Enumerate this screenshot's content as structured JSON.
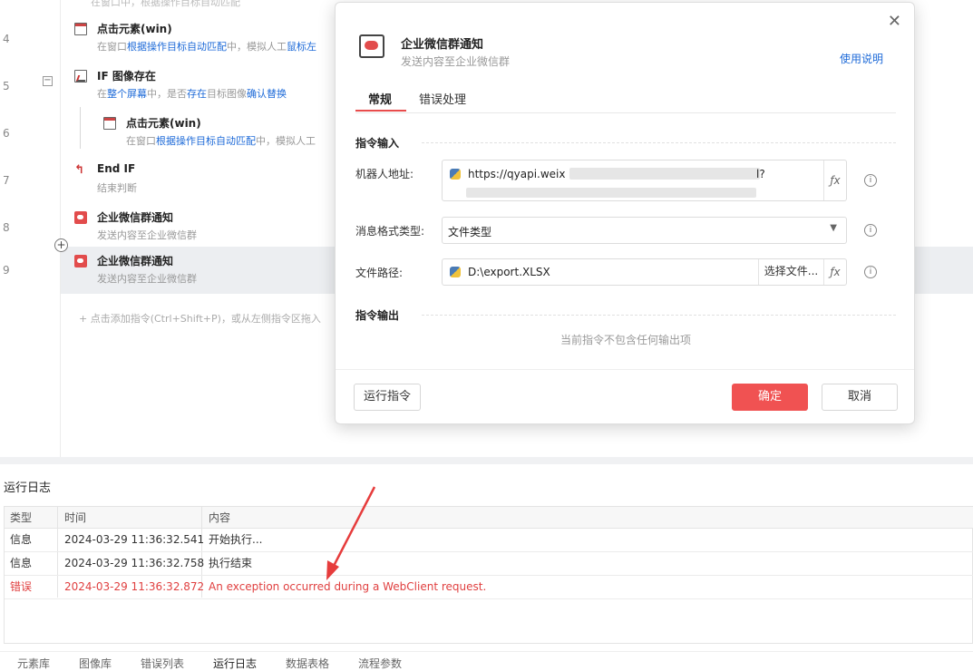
{
  "flow": {
    "top_text": "在窗口中，根据操作目标自动匹配",
    "rows": [
      {
        "num": "4",
        "title": "点击元素(win)",
        "desc_a": "在窗口",
        "desc_b": "根据操作目标自动匹配",
        "desc_c": "中，模拟人工",
        "desc_d": "鼠标左"
      },
      {
        "num": "5",
        "title": "IF 图像存在",
        "desc_a": "在",
        "desc_b": "整个屏幕",
        "desc_c": "中，是否",
        "desc_d": "存在",
        "desc_e": "目标图像",
        "desc_f": "确认替换"
      },
      {
        "num": "6",
        "title": "点击元素(win)",
        "desc_a": "在窗口",
        "desc_b": "根据操作目标自动匹配",
        "desc_c": "中，模拟人工"
      },
      {
        "num": "7",
        "title": "End IF",
        "desc": "结束判断"
      },
      {
        "num": "8",
        "title": "企业微信群通知",
        "desc": "发送内容至企业微信群"
      },
      {
        "num": "9",
        "title": "企业微信群通知",
        "desc": "发送内容至企业微信群"
      }
    ],
    "collapse_symbol": "−",
    "plus_symbol": "+",
    "add_hint": "+ 点击添加指令(Ctrl+Shift+P)，或从左侧指令区拖入"
  },
  "dialog": {
    "title": "企业微信群通知",
    "subtitle": "发送内容至企业微信群",
    "help_link": "使用说明",
    "close_symbol": "✕",
    "tabs": [
      "常规",
      "错误处理"
    ],
    "section_input": "指令输入",
    "section_output": "指令输出",
    "fields": {
      "robot_label": "机器人地址:",
      "robot_value": "https://qyapi.weix",
      "robot_tail": "l?",
      "format_label": "消息格式类型:",
      "format_value": "文件类型",
      "path_label": "文件路径:",
      "path_value": "D:\\export.XLSX",
      "choose_file": "选择文件...",
      "fx": "ƒx",
      "info": "i"
    },
    "no_output": "当前指令不包含任何输出项",
    "run_button": "运行指令",
    "ok_button": "确定",
    "cancel_button": "取消"
  },
  "log": {
    "title": "运行日志",
    "headers": [
      "类型",
      "时间",
      "内容"
    ],
    "rows": [
      {
        "type": "信息",
        "time": "2024-03-29 11:36:32.541",
        "content": "开始执行..."
      },
      {
        "type": "信息",
        "time": "2024-03-29 11:36:32.758",
        "content": "执行结束"
      },
      {
        "type": "错误",
        "time": "2024-03-29 11:36:32.872",
        "content": "An exception occurred during a WebClient request."
      }
    ],
    "error_color": "#e04040"
  },
  "bottom_tabs": [
    "元素库",
    "图像库",
    "错误列表",
    "运行日志",
    "数据表格",
    "流程参数"
  ],
  "colors": {
    "accent": "#f05252",
    "link": "#1d6ad8"
  }
}
